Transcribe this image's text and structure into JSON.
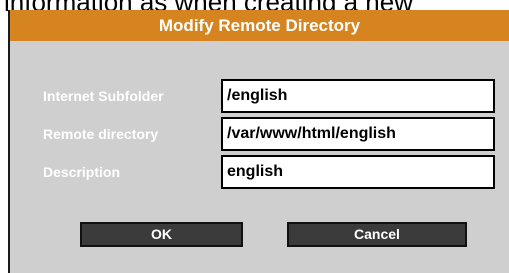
{
  "background_text": "information as when creating a new",
  "dialog": {
    "title": "Modify Remote Directory",
    "fields": [
      {
        "label": "Internet Subfolder",
        "value": "/english"
      },
      {
        "label": "Remote directory",
        "value": "/var/www/html/english"
      },
      {
        "label": "Description",
        "value": "english"
      }
    ],
    "buttons": {
      "ok": "OK",
      "cancel": "Cancel"
    }
  },
  "colors": {
    "title_bar": "#d6841f",
    "dialog_bg": "#cfcfcf",
    "button_bg": "#3b3b3b",
    "label_text": "#ffffff"
  }
}
